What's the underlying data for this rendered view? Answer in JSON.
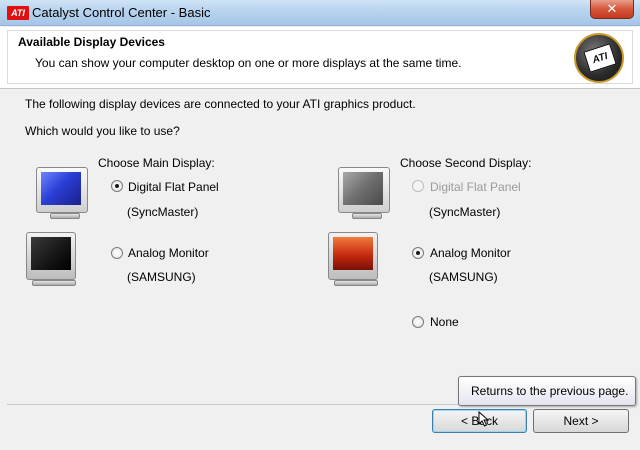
{
  "window": {
    "title": "Catalyst Control Center - Basic",
    "logo_text": "ATI",
    "close_glyph": "✕"
  },
  "header": {
    "title": "Available Display Devices",
    "subtitle": "You can show your computer desktop on one or more displays at the same time.",
    "badge_text": "ATI"
  },
  "body": {
    "intro": "The following display devices are connected to your ATI graphics product.",
    "question": "Which would you like to use?"
  },
  "main_display": {
    "heading": "Choose Main Display:",
    "options": [
      {
        "label": "Digital Flat Panel",
        "sub": "(SyncMaster)",
        "checked": true,
        "enabled": true
      },
      {
        "label": "Analog Monitor",
        "sub": "(SAMSUNG)",
        "checked": false,
        "enabled": true
      }
    ]
  },
  "second_display": {
    "heading": "Choose Second Display:",
    "options": [
      {
        "label": "Digital Flat Panel",
        "sub": "(SyncMaster)",
        "checked": false,
        "enabled": false
      },
      {
        "label": "Analog Monitor",
        "sub": "(SAMSUNG)",
        "checked": true,
        "enabled": true
      },
      {
        "label": "None",
        "sub": "",
        "checked": false,
        "enabled": true
      }
    ]
  },
  "buttons": {
    "back": "< Back",
    "next": "Next >"
  },
  "tooltip": "Returns to the previous page.",
  "colors": {
    "screen_blue": "#2b3fd6",
    "screen_gray": "#6e6e6e",
    "screen_black": "#141414",
    "screen_red": "#c52a10",
    "close_red": "#c23a20"
  }
}
